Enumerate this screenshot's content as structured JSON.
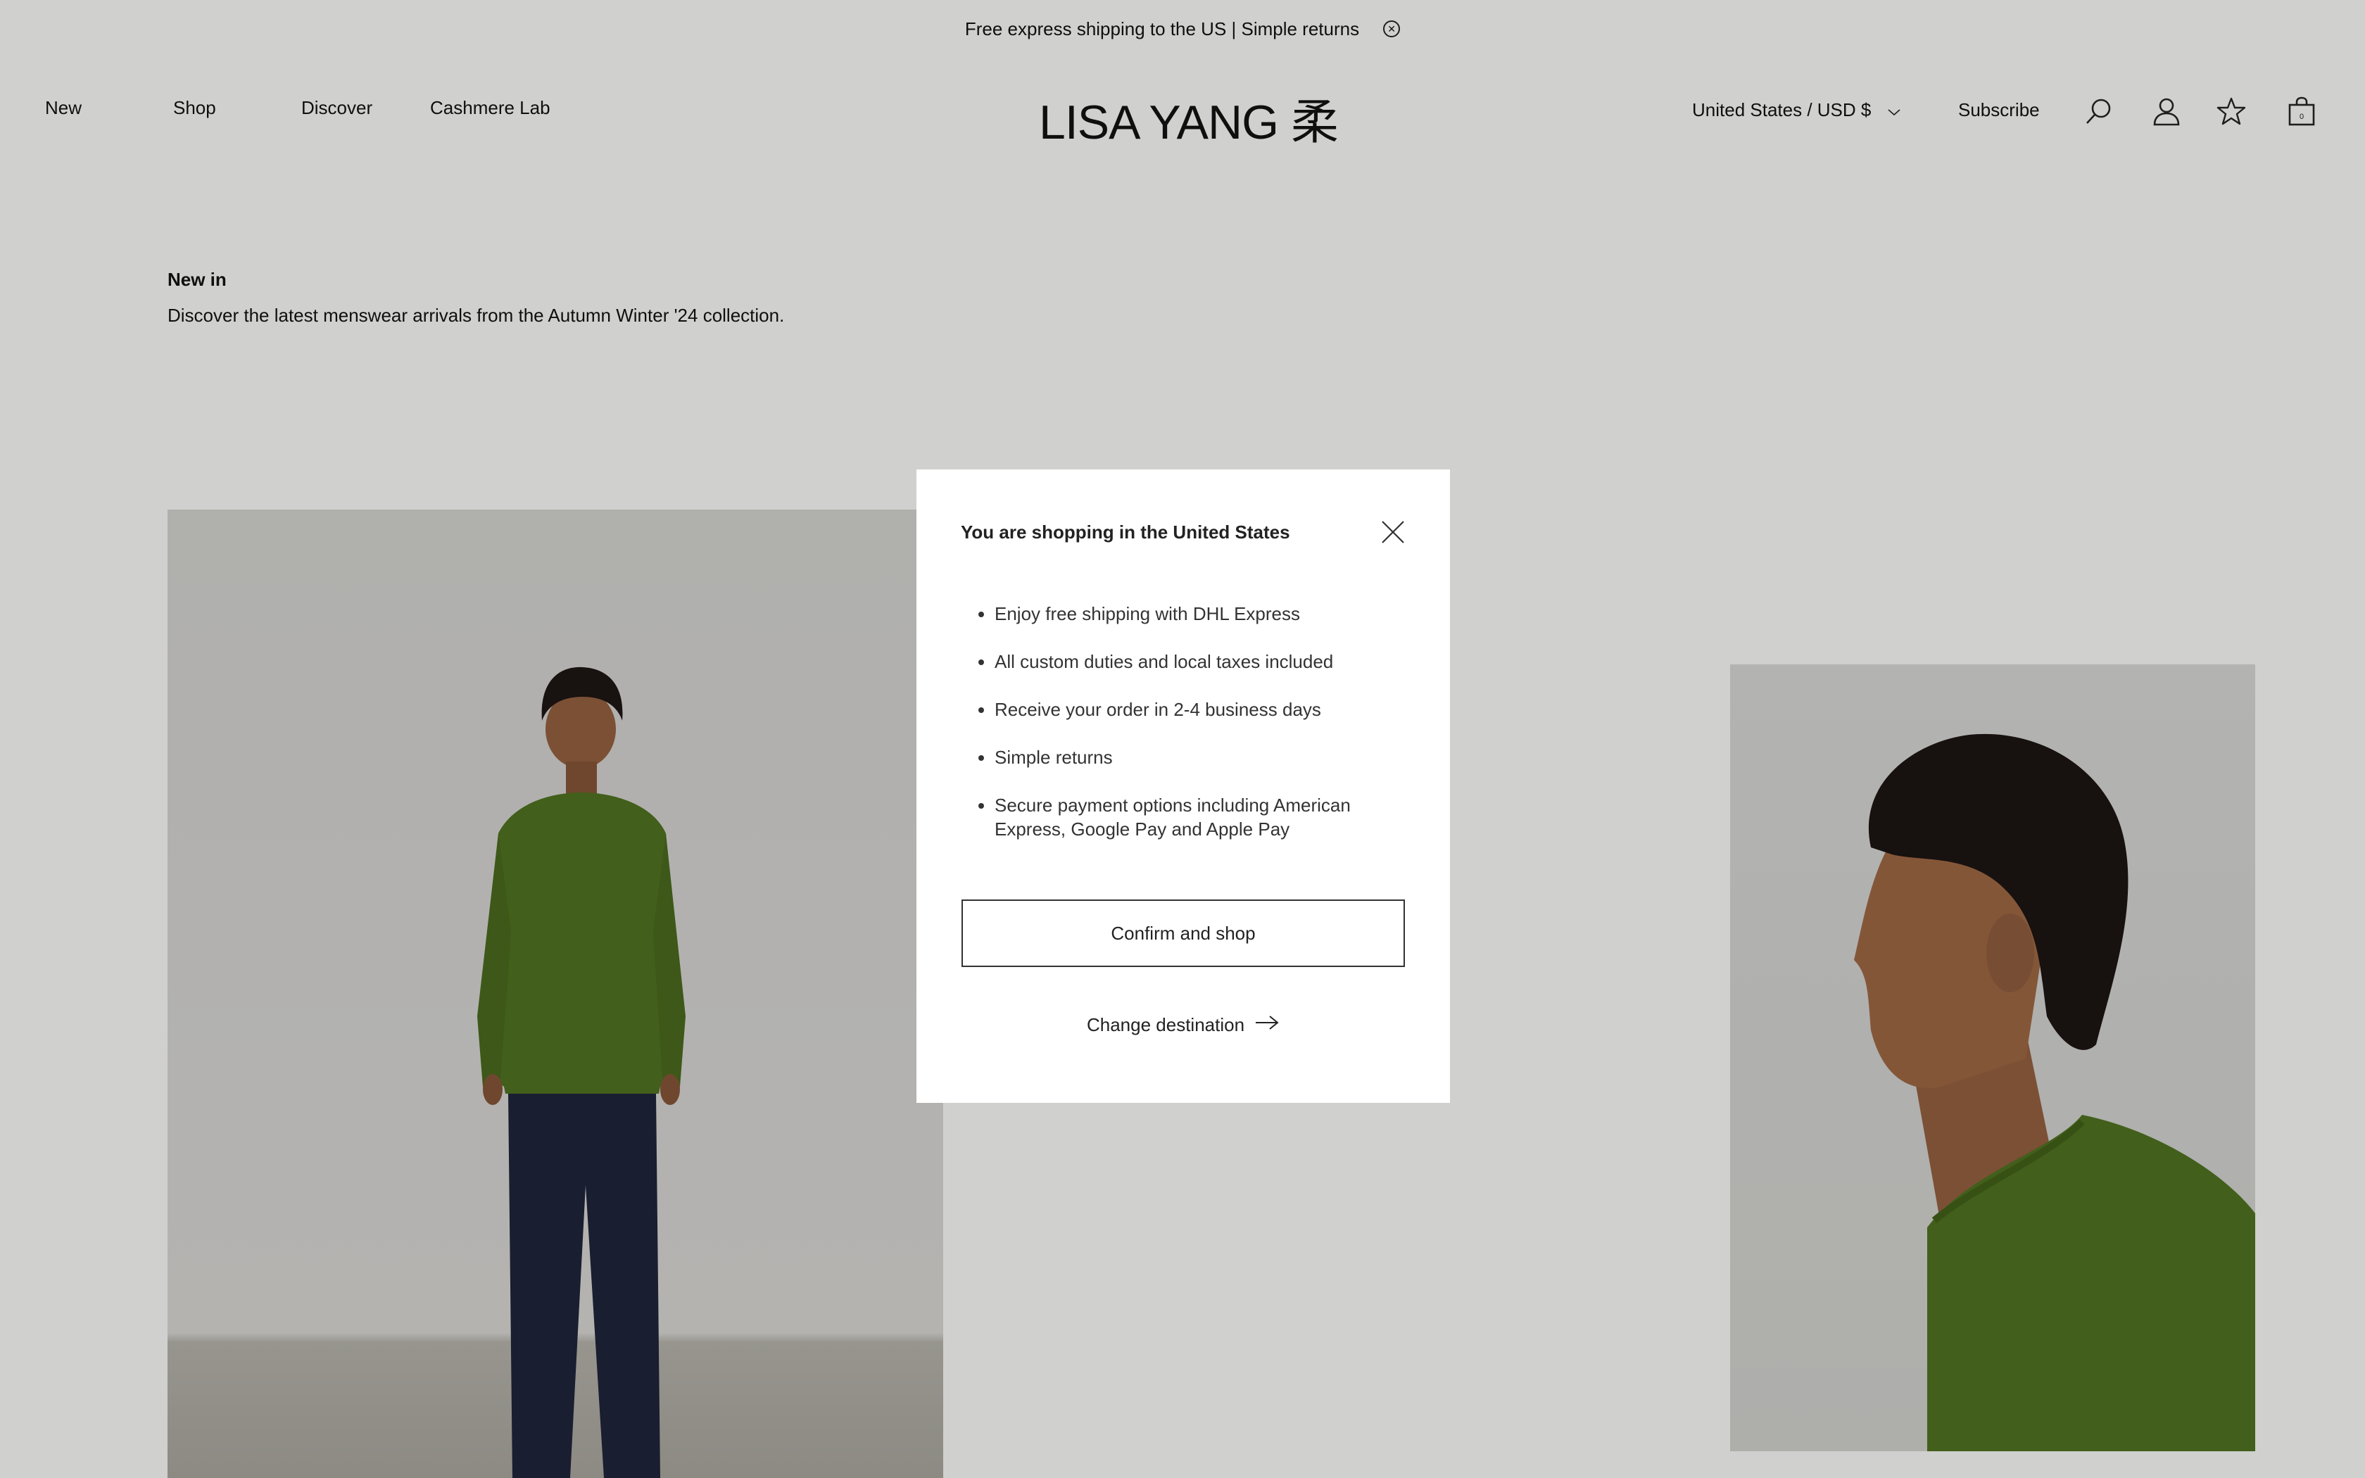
{
  "announcement": {
    "text": "Free express shipping to the US | Simple returns",
    "close_icon": "circle-x-icon"
  },
  "header": {
    "nav": [
      "New",
      "Shop",
      "Discover",
      "Cashmere Lab"
    ],
    "logo": "LISA YANG 柔",
    "region": "United States / USD $",
    "subscribe": "Subscribe",
    "icons": [
      "search-icon",
      "account-icon",
      "wishlist-star-icon",
      "cart-bag-icon"
    ],
    "cart_count": "0"
  },
  "intro": {
    "title": "New in",
    "description": "Discover the latest menswear arrivals from the Autumn Winter '24 collection."
  },
  "modal": {
    "title": "You are shopping in the United States",
    "benefits": [
      "Enjoy free shipping with DHL Express",
      "All custom duties and local taxes included",
      "Receive your order in 2-4 business days",
      "Simple returns",
      "Secure payment options including American Express, Google Pay and Apple Pay"
    ],
    "confirm_label": "Confirm and shop",
    "change_label": "Change destination"
  },
  "colors": {
    "sweater": "#4a6a1f",
    "trousers": "#1c2236",
    "overlay": "rgba(0,0,0,0.10)"
  }
}
